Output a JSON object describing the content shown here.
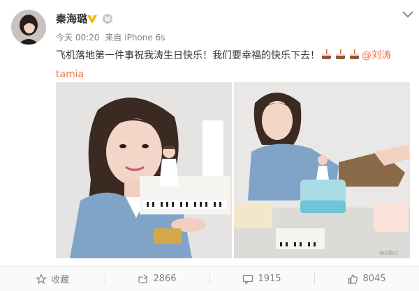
{
  "post": {
    "author": "秦海璐",
    "time": "今天 00:20",
    "source_prefix": "来自",
    "source": "iPhone 6s",
    "text": "飞机落地第一件事祝我涛生日快乐！我们要幸福的快乐下去！",
    "mention": "@刘涛tamia",
    "cake_count": 3,
    "watermark": "weibo"
  },
  "actions": {
    "favorite": "收藏",
    "repost": "2866",
    "comment": "1915",
    "like": "8045"
  },
  "colors": {
    "link": "#eb7350",
    "verified": "#f5b800",
    "meta": "#808080"
  },
  "icons": [
    "avatar",
    "verified-icon",
    "member-badge-icon",
    "chevron-down-icon",
    "cake-icon",
    "star-icon",
    "repost-icon",
    "comment-icon",
    "like-icon"
  ]
}
